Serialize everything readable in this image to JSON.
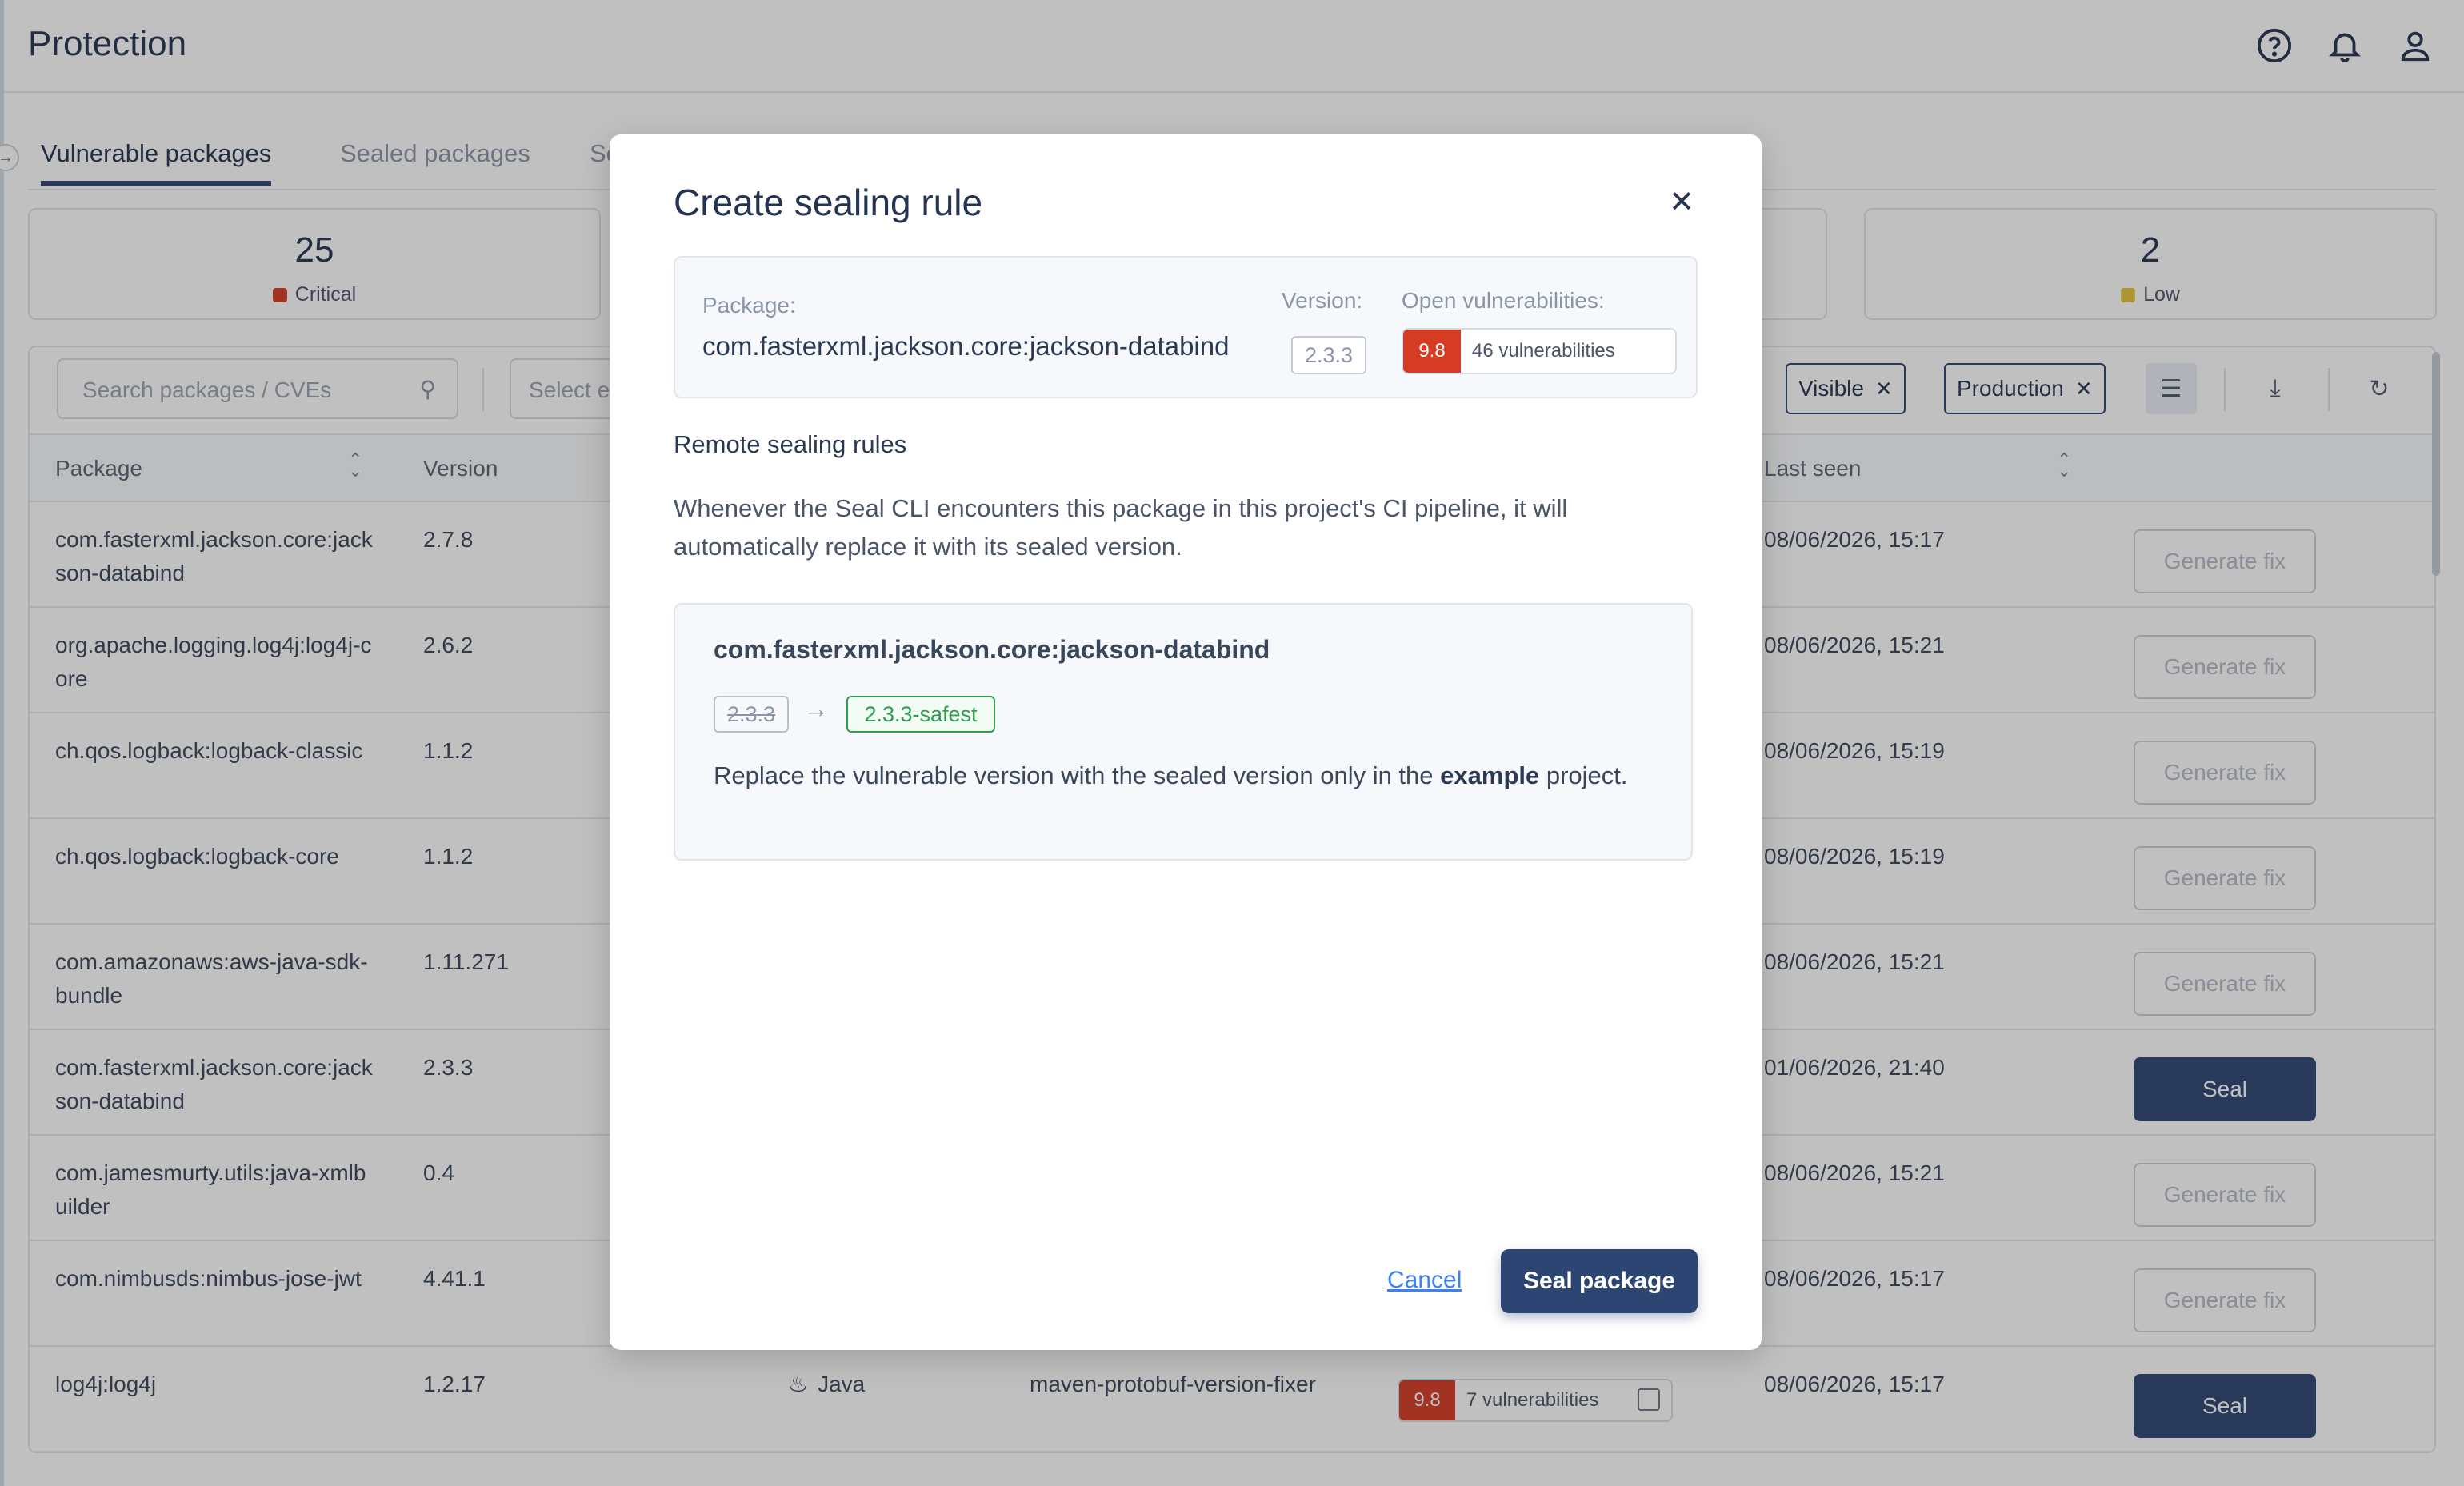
{
  "header": {
    "title": "Protection",
    "icons": [
      "help-icon",
      "bell-icon",
      "user-icon"
    ]
  },
  "tabs": [
    {
      "label": "Vulnerable packages",
      "active": true
    },
    {
      "label": "Sealed packages",
      "active": false
    },
    {
      "label": "Se",
      "active": false
    }
  ],
  "stats": [
    {
      "value": "25",
      "label": "Critical",
      "color": "#d63b24"
    },
    {
      "value": "2",
      "label": "Low",
      "color": "#e5c43a"
    }
  ],
  "toolbar": {
    "search_placeholder": "Search packages / CVEs",
    "select_placeholder": "Select e",
    "chips": [
      {
        "label": "Visible"
      },
      {
        "label": "Production"
      }
    ]
  },
  "table": {
    "columns": {
      "package": "Package",
      "version": "Version",
      "last_seen": "Last seen"
    },
    "rows": [
      {
        "package": "com.fasterxml.jackson.core:jackson-databind",
        "version": "2.7.8",
        "last_seen": "08/06/2026, 15:17",
        "action": "Generate fix"
      },
      {
        "package": "org.apache.logging.log4j:log4j-core",
        "version": "2.6.2",
        "last_seen": "08/06/2026, 15:21",
        "action": "Generate fix"
      },
      {
        "package": "ch.qos.logback:logback-classic",
        "version": "1.1.2",
        "last_seen": "08/06/2026, 15:19",
        "action": "Generate fix"
      },
      {
        "package": "ch.qos.logback:logback-core",
        "version": "1.1.2",
        "last_seen": "08/06/2026, 15:19",
        "action": "Generate fix"
      },
      {
        "package": "com.amazonaws:aws-java-sdk-bundle",
        "version": "1.11.271",
        "last_seen": "08/06/2026, 15:21",
        "action": "Generate fix"
      },
      {
        "package": "com.fasterxml.jackson.core:jackson-databind",
        "version": "2.3.3",
        "last_seen": "01/06/2026, 21:40",
        "action": "Seal"
      },
      {
        "package": "com.jamesmurty.utils:java-xmlbuilder",
        "version": "0.4",
        "last_seen": "08/06/2026, 15:21",
        "action": "Generate fix"
      },
      {
        "package": "com.nimbusds:nimbus-jose-jwt",
        "version": "4.41.1",
        "last_seen": "08/06/2026, 15:17",
        "action": "Generate fix"
      },
      {
        "package": "log4j:log4j",
        "version": "1.2.17",
        "language": "Java",
        "fixer": "maven-protobuf-version-fixer",
        "score": "9.8",
        "vulns": "7 vulnerabilities",
        "last_seen": "08/06/2026, 15:17",
        "action": "Seal"
      }
    ]
  },
  "modal": {
    "title": "Create sealing rule",
    "package_label": "Package:",
    "package_value": "com.fasterxml.jackson.core:jackson-databind",
    "version_label": "Version:",
    "version_value": "2.3.3",
    "open_vulns_label": "Open vulnerabilities:",
    "score": "9.8",
    "vulns_text": "46 vulnerabilities",
    "section_title": "Remote sealing rules",
    "section_desc": "Whenever the Seal CLI encounters this package in this project's CI pipeline, it will automatically replace it with its sealed version.",
    "rule": {
      "package": "com.fasterxml.jackson.core:jackson-databind",
      "old_version": "2.3.3",
      "arrow": "→",
      "new_version": "2.3.3-safest",
      "desc_prefix": "Replace the vulnerable version with the sealed version only in the ",
      "desc_bold": "example",
      "desc_suffix": " project."
    },
    "cancel_label": "Cancel",
    "confirm_label": "Seal package"
  },
  "colors": {
    "primary": "#2d4572",
    "critical": "#d63b24",
    "safe": "#2e9b4e",
    "link": "#3b82f6"
  }
}
